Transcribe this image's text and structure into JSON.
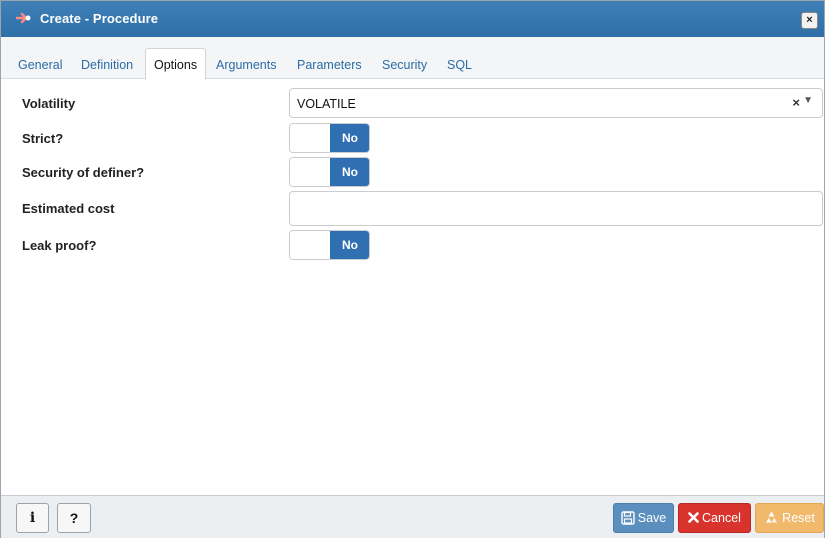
{
  "dialog": {
    "title": "Create - Procedure",
    "close_label": "×"
  },
  "tabs": [
    {
      "label": "General"
    },
    {
      "label": "Definition"
    },
    {
      "label": "Options",
      "active": true
    },
    {
      "label": "Arguments"
    },
    {
      "label": "Parameters"
    },
    {
      "label": "Security"
    },
    {
      "label": "SQL"
    }
  ],
  "form": {
    "volatility": {
      "label": "Volatility",
      "value": "VOLATILE",
      "clear": "×",
      "arrow": "▼"
    },
    "strict": {
      "label": "Strict?",
      "state": "No"
    },
    "security_definer": {
      "label": "Security of definer?",
      "state": "No"
    },
    "estimated_cost": {
      "label": "Estimated cost",
      "value": ""
    },
    "leak_proof": {
      "label": "Leak proof?",
      "state": "No"
    }
  },
  "footer": {
    "info_label": "i",
    "help_label": "?",
    "save_label": "Save",
    "cancel_label": "Cancel",
    "reset_label": "Reset"
  },
  "colors": {
    "accent": "#2f6fb2",
    "title_bar": "#3a79b2",
    "save": "#5a8fbe",
    "cancel": "#d9332e",
    "reset": "#f0b96b"
  },
  "icons": {
    "title": "procedure-arrow-icon",
    "save": "floppy-disk-icon",
    "cancel": "x-icon",
    "reset": "recycle-icon"
  }
}
